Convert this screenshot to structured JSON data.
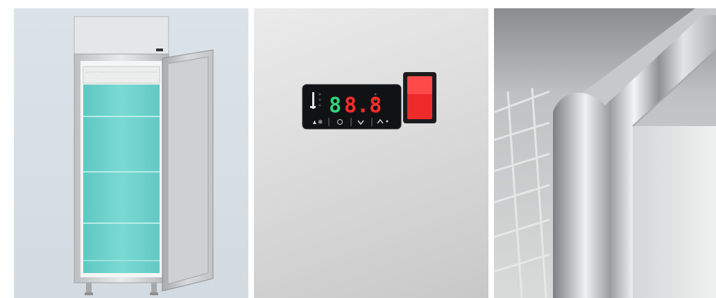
{
  "panels": [
    {
      "id": "cabinet-open-view",
      "kind": "product-photo"
    },
    {
      "id": "controller-closeup",
      "kind": "product-photo"
    },
    {
      "id": "door-gasket-closeup",
      "kind": "product-photo"
    }
  ],
  "controller": {
    "readout_green": "8",
    "readout_red": "8.8",
    "icons": [
      "snowflake-icon",
      "power-icon",
      "down-arrow-icon",
      "up-arrow-icon"
    ]
  },
  "colors": {
    "interior_cyan": "#6fd3cc",
    "display_red": "#ff2b2b",
    "display_green": "#31d27a",
    "switch_red": "#ee2a2a"
  }
}
